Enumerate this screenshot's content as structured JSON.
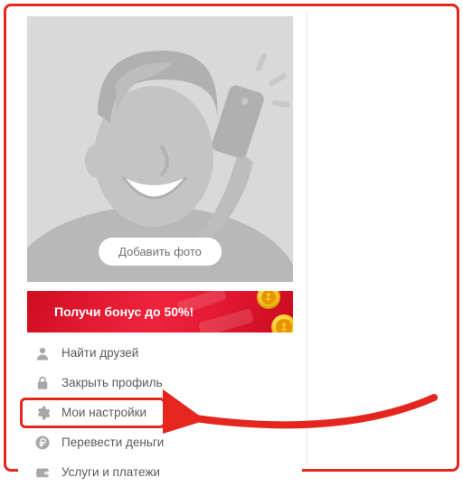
{
  "avatar": {
    "add_photo_label": "Добавить фото"
  },
  "bonus": {
    "text": "Получи бонус до 50%!"
  },
  "menu": {
    "items": [
      {
        "label": "Найти друзей"
      },
      {
        "label": "Закрыть профиль"
      },
      {
        "label": "Мои настройки"
      },
      {
        "label": "Перевести деньги"
      },
      {
        "label": "Услуги и платежи"
      }
    ]
  }
}
